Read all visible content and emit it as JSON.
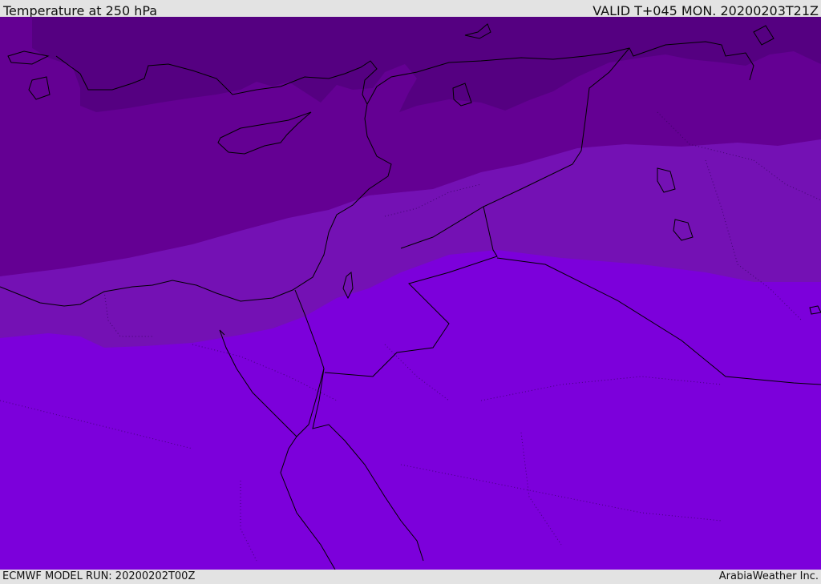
{
  "header": {
    "title": "Temperature at 250 hPa",
    "valid": "VALID T+045 MON. 20200203T21Z"
  },
  "footer": {
    "model_run": "ECMWF MODEL RUN: 20200202T00Z",
    "credit": "ArabiaWeather Inc."
  },
  "map": {
    "colors": {
      "band_coldest": "#550081",
      "band_cold": "#640093",
      "band_mid": "#7411b4",
      "band_warm": "#7c00db",
      "coast": "#000000"
    }
  }
}
